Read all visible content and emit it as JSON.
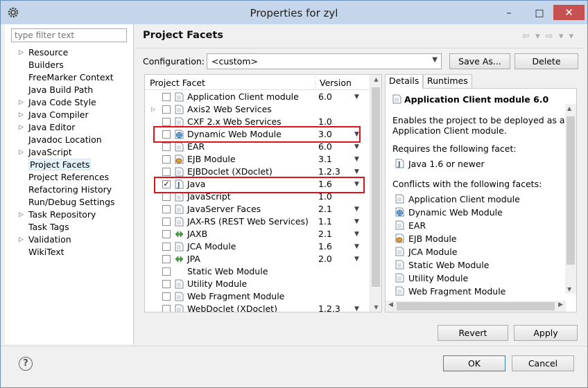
{
  "window": {
    "title": "Properties for zyl",
    "minimize": "–",
    "maximize": "□",
    "close": "✕"
  },
  "nav": {
    "filter_placeholder": "type filter text",
    "items": [
      {
        "label": "Resource",
        "expandable": true
      },
      {
        "label": "Builders",
        "expandable": false
      },
      {
        "label": "FreeMarker Context",
        "expandable": false
      },
      {
        "label": "Java Build Path",
        "expandable": false
      },
      {
        "label": "Java Code Style",
        "expandable": true
      },
      {
        "label": "Java Compiler",
        "expandable": true
      },
      {
        "label": "Java Editor",
        "expandable": true
      },
      {
        "label": "Javadoc Location",
        "expandable": false
      },
      {
        "label": "JavaScript",
        "expandable": true
      },
      {
        "label": "Project Facets",
        "expandable": false,
        "selected": true
      },
      {
        "label": "Project References",
        "expandable": false
      },
      {
        "label": "Refactoring History",
        "expandable": false
      },
      {
        "label": "Run/Debug Settings",
        "expandable": false
      },
      {
        "label": "Task Repository",
        "expandable": true
      },
      {
        "label": "Task Tags",
        "expandable": false
      },
      {
        "label": "Validation",
        "expandable": true
      },
      {
        "label": "WikiText",
        "expandable": false
      }
    ]
  },
  "page": {
    "title": "Project Facets",
    "nav_arrows": "⇦ ▾ ⇨ ▾ ▾",
    "config_label": "Configuration:",
    "config_value": "<custom>",
    "save_as": "Save As...",
    "delete": "Delete"
  },
  "facets": {
    "col_facet": "Project Facet",
    "col_version": "Version",
    "rows": [
      {
        "name": "Application Client module",
        "version": "6.0",
        "checked": false,
        "icon": "module-icon",
        "dropdown": true,
        "expandable": false
      },
      {
        "name": "Axis2 Web Services",
        "version": "",
        "checked": false,
        "icon": "module-icon",
        "dropdown": false,
        "expandable": true
      },
      {
        "name": "CXF 2.x Web Services",
        "version": "1.0",
        "checked": false,
        "icon": "module-icon",
        "dropdown": false,
        "expandable": false
      },
      {
        "name": "Dynamic Web Module",
        "version": "3.0",
        "checked": false,
        "icon": "globe-icon",
        "dropdown": true,
        "expandable": false
      },
      {
        "name": "EAR",
        "version": "6.0",
        "checked": false,
        "icon": "module-icon",
        "dropdown": true,
        "expandable": false
      },
      {
        "name": "EJB Module",
        "version": "3.1",
        "checked": false,
        "icon": "bean-icon",
        "dropdown": true,
        "expandable": false
      },
      {
        "name": "EJBDoclet (XDoclet)",
        "version": "1.2.3",
        "checked": false,
        "icon": "module-icon",
        "dropdown": true,
        "expandable": false
      },
      {
        "name": "Java",
        "version": "1.6",
        "checked": true,
        "icon": "java-icon",
        "dropdown": true,
        "expandable": false
      },
      {
        "name": "JavaScript",
        "version": "1.0",
        "checked": false,
        "icon": "module-icon",
        "dropdown": false,
        "expandable": false
      },
      {
        "name": "JavaServer Faces",
        "version": "2.1",
        "checked": false,
        "icon": "module-icon",
        "dropdown": true,
        "expandable": false
      },
      {
        "name": "JAX-RS (REST Web Services)",
        "version": "1.1",
        "checked": false,
        "icon": "module-icon",
        "dropdown": true,
        "expandable": false
      },
      {
        "name": "JAXB",
        "version": "2.1",
        "checked": false,
        "icon": "jaxb-icon",
        "dropdown": true,
        "expandable": false
      },
      {
        "name": "JCA Module",
        "version": "1.6",
        "checked": false,
        "icon": "module-icon",
        "dropdown": true,
        "expandable": false
      },
      {
        "name": "JPA",
        "version": "2.0",
        "checked": false,
        "icon": "jaxb-icon",
        "dropdown": true,
        "expandable": false
      },
      {
        "name": "Static Web Module",
        "version": "",
        "checked": false,
        "icon": "none",
        "dropdown": false,
        "expandable": false
      },
      {
        "name": "Utility Module",
        "version": "",
        "checked": false,
        "icon": "module-icon",
        "dropdown": false,
        "expandable": false
      },
      {
        "name": "Web Fragment Module",
        "version": "",
        "checked": false,
        "icon": "module-icon",
        "dropdown": false,
        "expandable": false
      },
      {
        "name": "WebDoclet (XDoclet)",
        "version": "1.2.3",
        "checked": false,
        "icon": "module-icon",
        "dropdown": true,
        "expandable": false
      }
    ],
    "highlight_color": "#e3101a"
  },
  "details": {
    "tab_details": "Details",
    "tab_runtimes": "Runtimes",
    "title": "Application Client module 6.0",
    "description_1": "Enables the project to be deployed as a J",
    "description_2": "Application Client module.",
    "requires_label": "Requires the following facet:",
    "requires_item": "Java 1.6 or newer",
    "conflicts_label": "Conflicts with the following facets:",
    "conflicts": [
      {
        "name": "Application Client module",
        "icon": "module-icon"
      },
      {
        "name": "Dynamic Web Module",
        "icon": "globe-icon"
      },
      {
        "name": "EAR",
        "icon": "module-icon"
      },
      {
        "name": "EJB Module",
        "icon": "bean-icon"
      },
      {
        "name": "JCA Module",
        "icon": "module-icon"
      },
      {
        "name": "Static Web Module",
        "icon": "module-icon"
      },
      {
        "name": "Utility Module",
        "icon": "module-icon"
      },
      {
        "name": "Web Fragment Module",
        "icon": "module-icon"
      }
    ]
  },
  "buttons": {
    "revert": "Revert",
    "apply": "Apply",
    "ok": "OK",
    "cancel": "Cancel",
    "help": "?"
  }
}
